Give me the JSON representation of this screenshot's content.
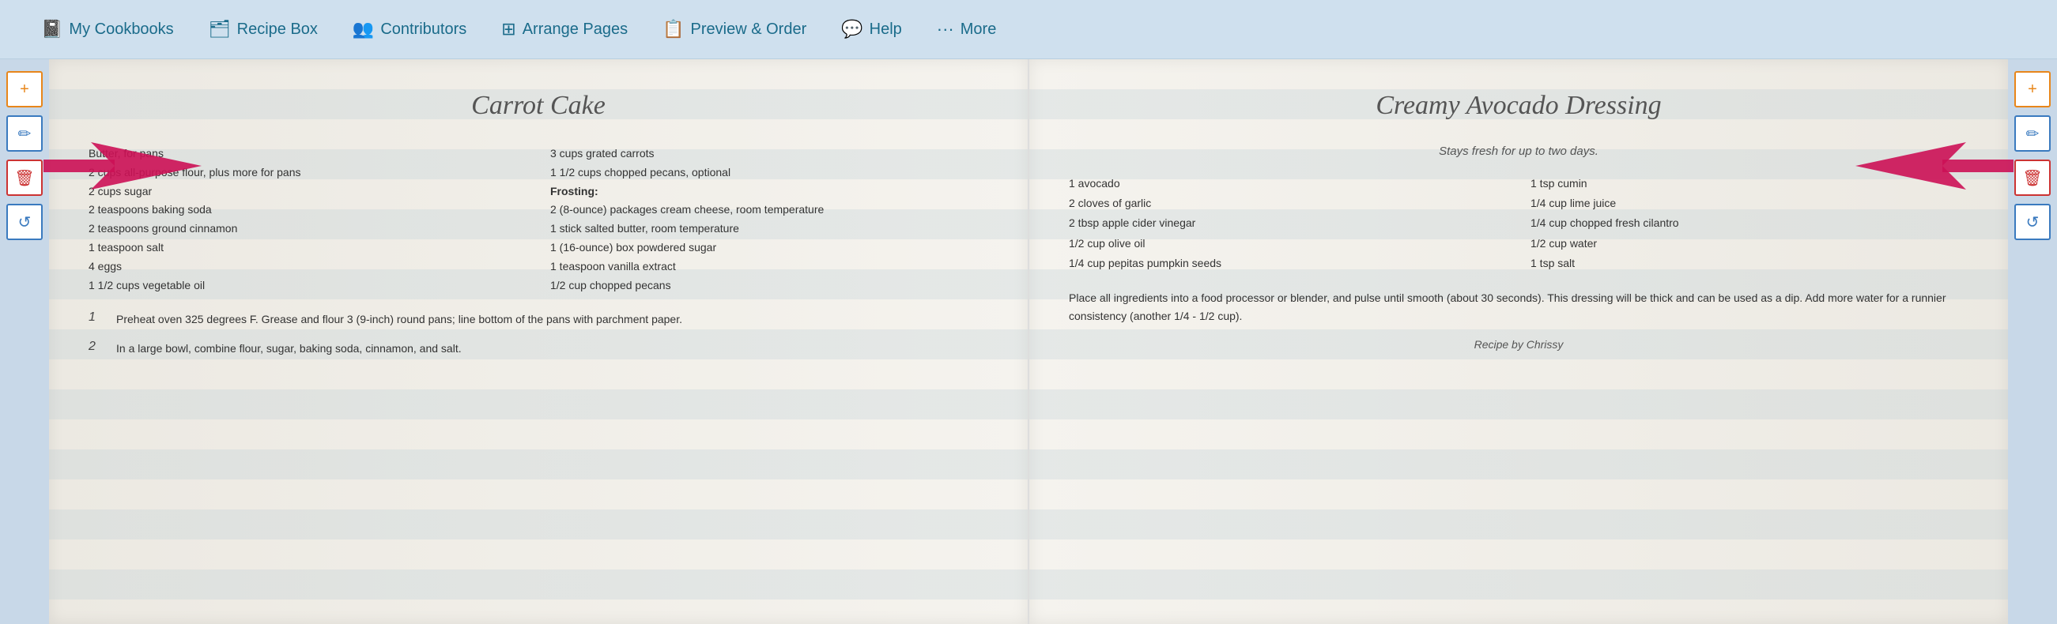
{
  "nav": {
    "items": [
      {
        "id": "my-cookbooks",
        "icon": "📓",
        "label": "My Cookbooks"
      },
      {
        "id": "recipe-box",
        "icon": "🗂",
        "label": "Recipe Box"
      },
      {
        "id": "contributors",
        "icon": "👥",
        "label": "Contributors"
      },
      {
        "id": "arrange-pages",
        "icon": "⊞",
        "label": "Arrange Pages"
      },
      {
        "id": "preview-order",
        "icon": "📋",
        "label": "Preview & Order"
      },
      {
        "id": "help",
        "icon": "💬",
        "label": "Help"
      },
      {
        "id": "more",
        "icon": "···",
        "label": "More"
      }
    ]
  },
  "left_page": {
    "title": "Carrot Cake",
    "ingredients_col1": [
      "Butter, for pans",
      "2 cups all-purpose flour, plus more for pans",
      "2 cups sugar",
      "2 teaspoons baking soda",
      "2 teaspoons ground cinnamon",
      "1 teaspoon salt",
      "4 eggs",
      "1 1/2 cups vegetable oil"
    ],
    "ingredients_col2": [
      "3 cups grated carrots",
      "1 1/2 cups chopped pecans, optional",
      "Frosting:",
      "2 (8-ounce) packages cream cheese, room temperature",
      "1 stick salted butter, room temperature",
      "1 (16-ounce) box powdered sugar",
      "1 teaspoon vanilla extract",
      "1/2 cup chopped pecans"
    ],
    "steps": [
      {
        "number": "1",
        "text": "Preheat oven 325 degrees F. Grease and flour 3 (9-inch) round pans; line bottom of the pans with parchment paper."
      },
      {
        "number": "2",
        "text": "In a large bowl, combine flour, sugar, baking soda, cinnamon, and salt."
      }
    ]
  },
  "right_page": {
    "title": "Creamy Avocado Dressing",
    "subtitle": "Stays fresh for up to two days.",
    "ingredients_col1": [
      "1 avocado",
      "2 cloves of garlic",
      "2 tbsp apple cider vinegar",
      "1/2 cup olive oil",
      "1/4 cup pepitas pumpkin seeds"
    ],
    "ingredients_col2": [
      "1 tsp cumin",
      "1/4 cup lime juice",
      "1/4 cup chopped fresh cilantro",
      "1/2 cup water",
      "1 tsp salt"
    ],
    "body": "Place all ingredients into a food processor or blender, and pulse until smooth (about 30 seconds). This dressing will be thick and can be used as a dip. Add more water for a runnier consistency (another 1/4 - 1/2 cup).",
    "byline": "Recipe by Chrissy"
  },
  "side_buttons": {
    "add_label": "+",
    "edit_label": "✏",
    "delete_label": "🗑",
    "refresh_label": "↺"
  }
}
